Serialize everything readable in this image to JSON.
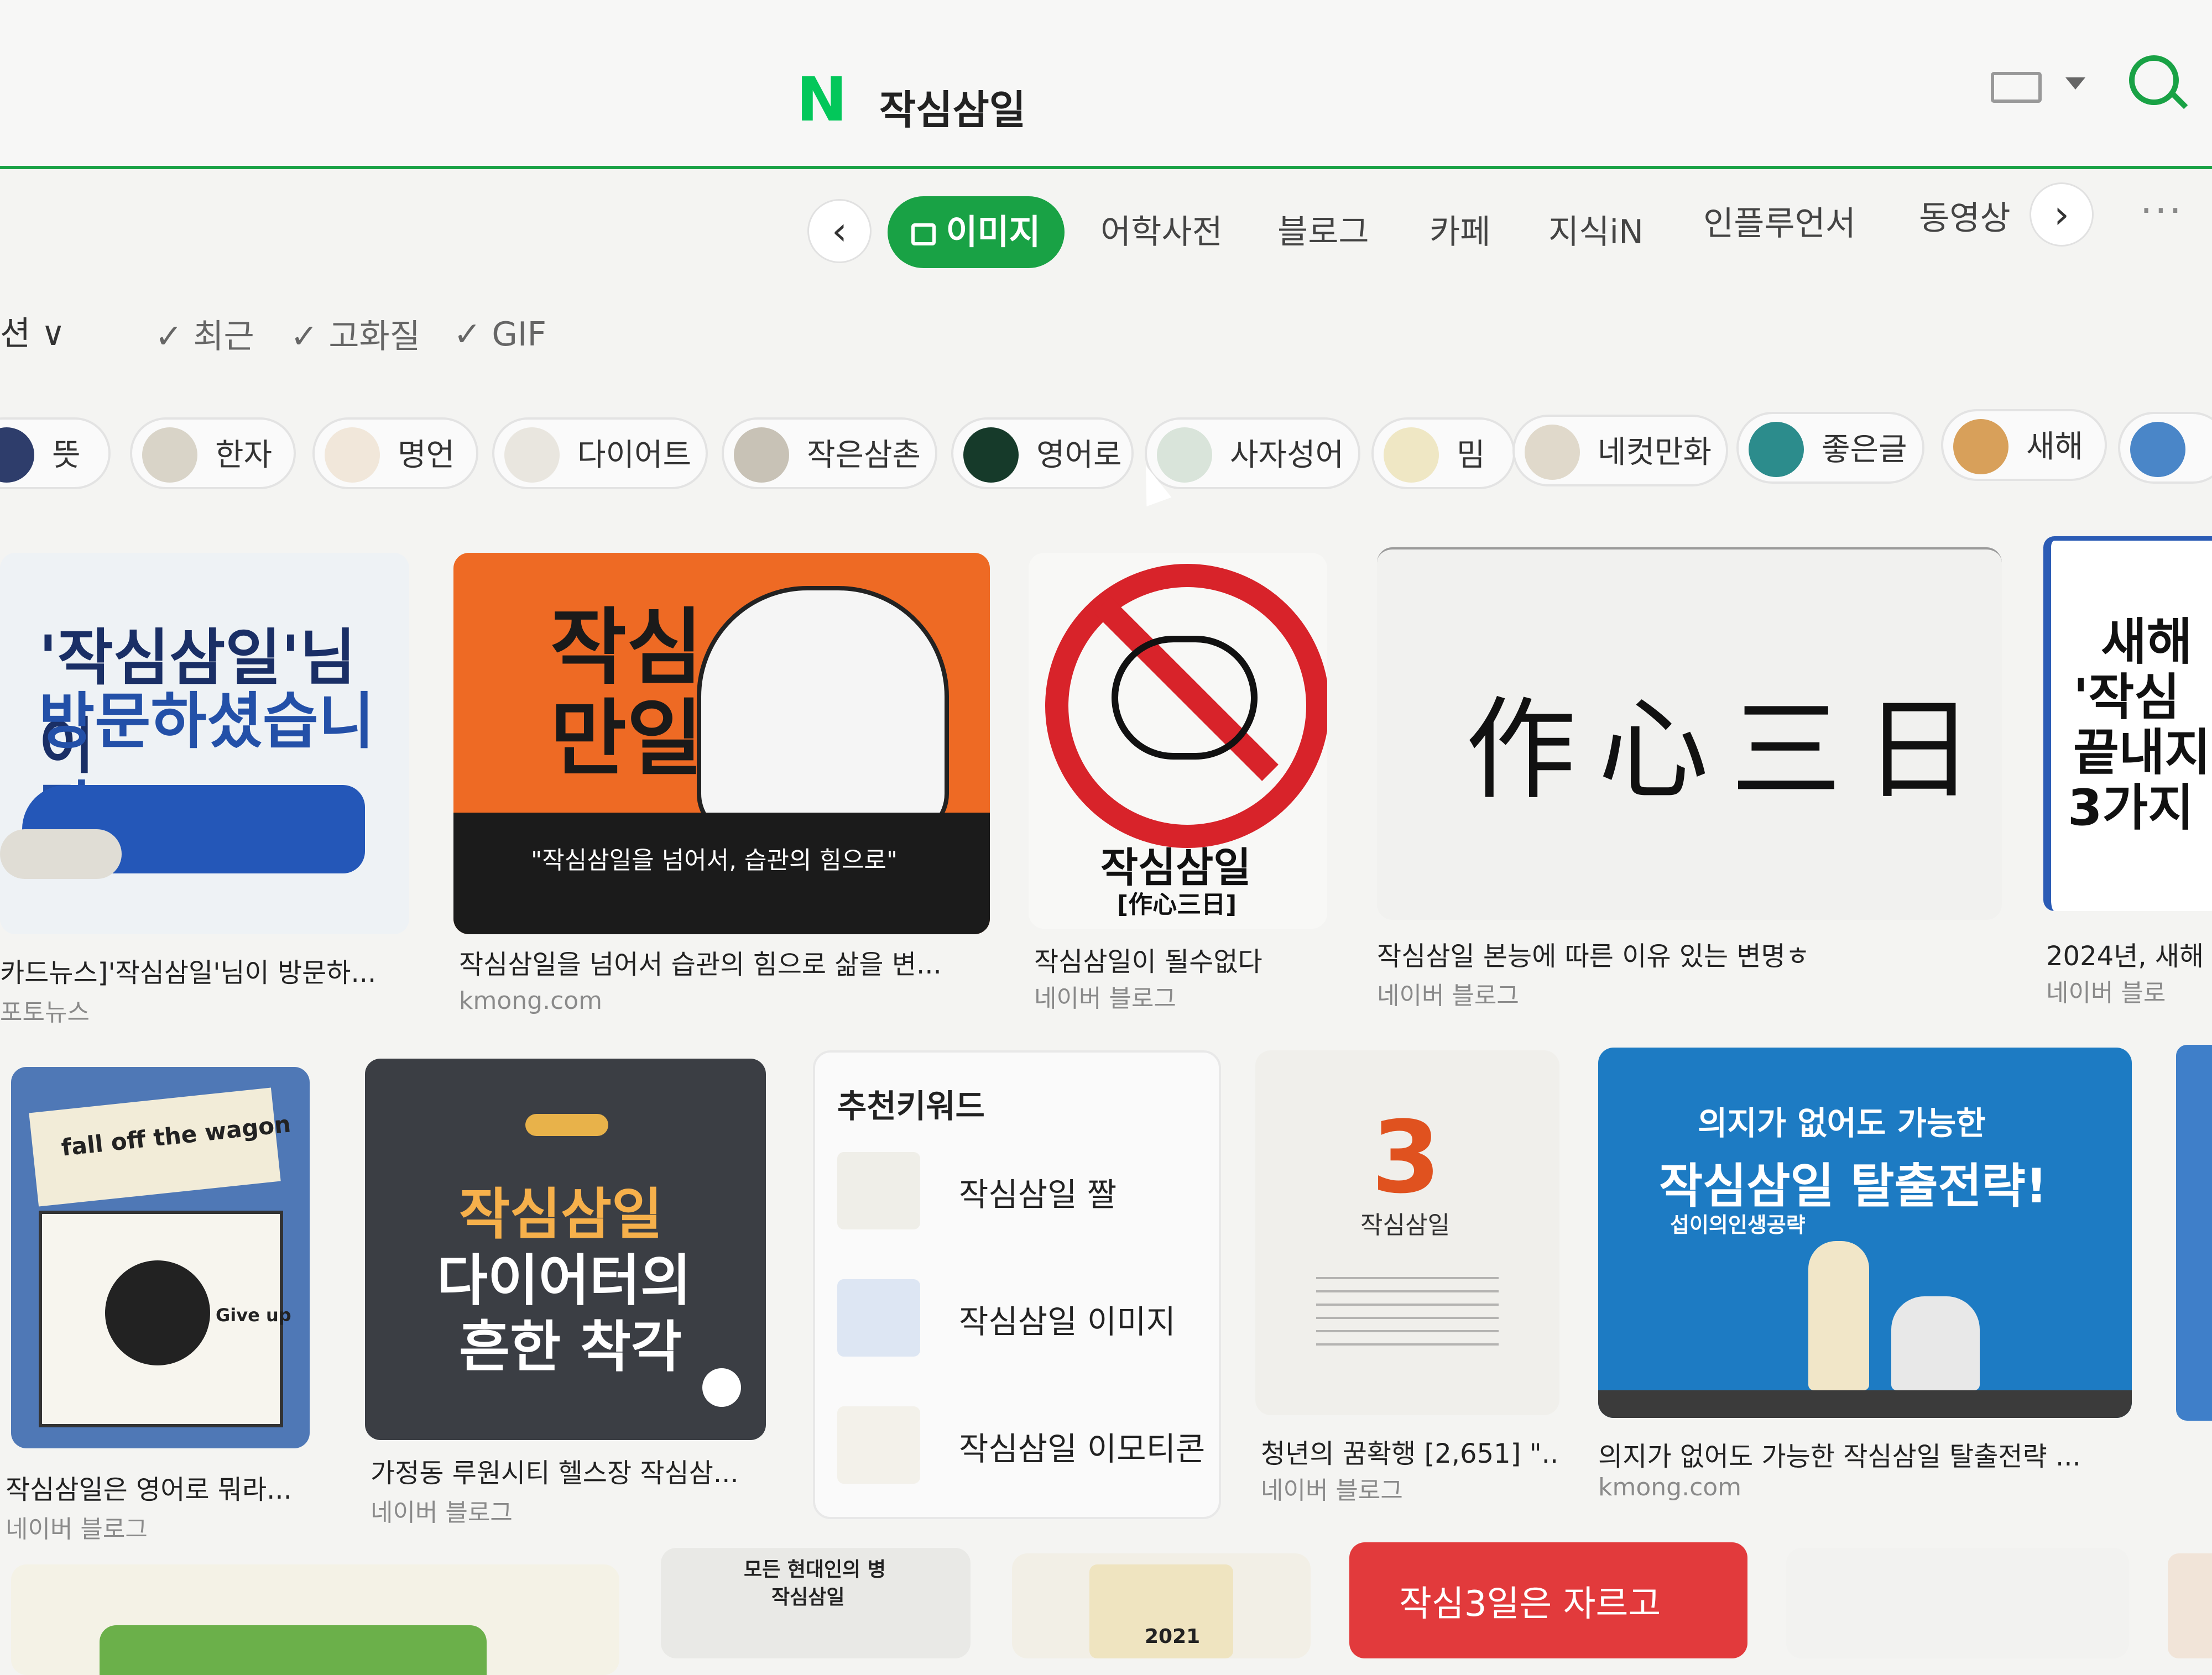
{
  "search": {
    "logo": "N",
    "query": "작심삼일"
  },
  "tabs": [
    {
      "label": "이미지",
      "active": true
    },
    {
      "label": "어학사전"
    },
    {
      "label": "블로그"
    },
    {
      "label": "카페"
    },
    {
      "label": "지식iN"
    },
    {
      "label": "인플루언서"
    },
    {
      "label": "동영상"
    }
  ],
  "tab_nav": {
    "prev": "‹",
    "next": "›",
    "more": "···"
  },
  "filters": {
    "option_label": "션",
    "chevron": "∨",
    "items": [
      "최근",
      "고화질",
      "GIF"
    ],
    "check": "✓"
  },
  "chips": [
    "뜻",
    "한자",
    "명언",
    "다이어트",
    "작은삼촌",
    "영어로",
    "사자성어",
    "밈",
    "네컷만화",
    "좋은글",
    "새해"
  ],
  "results_row1": [
    {
      "caption": "카드뉴스]'작심삼일'님이 방문하...",
      "source": "포토뉴스",
      "image_text_1": "'작심삼일'님이",
      "image_text_2": "방문하셨습니다"
    },
    {
      "caption": "작심삼일을 넘어서 습관의 힘으로 삶을 변...",
      "source": "kmong.com",
      "image_text_1": "작심",
      "image_text_2": "만일",
      "image_text_3": "\"작심삼일을 넘어서, 습관의 힘으로\""
    },
    {
      "caption": "작심삼일이 될수없다",
      "source": "네이버 블로그",
      "image_text_1": "작심삼일",
      "image_text_2": "[作心三日]"
    },
    {
      "caption": "작심삼일 본능에 따른 이유 있는 변명ㅎ",
      "source": "네이버 블로그",
      "image_text_1": "作心三日"
    },
    {
      "caption": "2024년, 새해",
      "source": "네이버 블로",
      "image_text_1": "새해",
      "image_text_2": "'작심",
      "image_text_3": "끝내지",
      "image_text_4": "3가지"
    }
  ],
  "results_row2": [
    {
      "caption": "작심삼일은 영어로 뭐라...",
      "source": "네이버 블로그",
      "image_text_1": "fall off the wagon",
      "image_text_2": "Give up"
    },
    {
      "caption": "가정동 루원시티 헬스장 작심삼...",
      "source": "네이버 블로그",
      "image_text_1": "작심삼일",
      "image_text_2": "다이어터의",
      "image_text_3": "흔한 착각"
    },
    {
      "caption": "청년의 꿈확행 [2,651] \"...",
      "source": "네이버 블로그",
      "image_text_1": "3",
      "image_text_2": "작심삼일"
    },
    {
      "caption": "의지가 없어도 가능한 작심삼일 탈출전략 ...",
      "source": "kmong.com",
      "image_text_1": "의지가 없어도 가능한",
      "image_text_2": "작심삼일 탈출전략!",
      "image_text_3": "섭이의인생공략"
    }
  ],
  "keywords": {
    "title": "추천키워드",
    "items": [
      "작심삼일 짤",
      "작심삼일 이미지",
      "작심삼일 이모티콘"
    ]
  },
  "row3": [
    {
      "image_text_1": "모든 현대인의 병",
      "image_text_2": "작심삼일"
    },
    {
      "image_text_1": "2021"
    },
    {
      "image_text_1": "작심3일은 자르고"
    }
  ],
  "colors": {
    "brand_green": "#19a245",
    "naver_green": "#03c75a",
    "orange": "#ee6a24",
    "red_sign": "#d8232a",
    "blue_banner": "#1d7bc3"
  }
}
